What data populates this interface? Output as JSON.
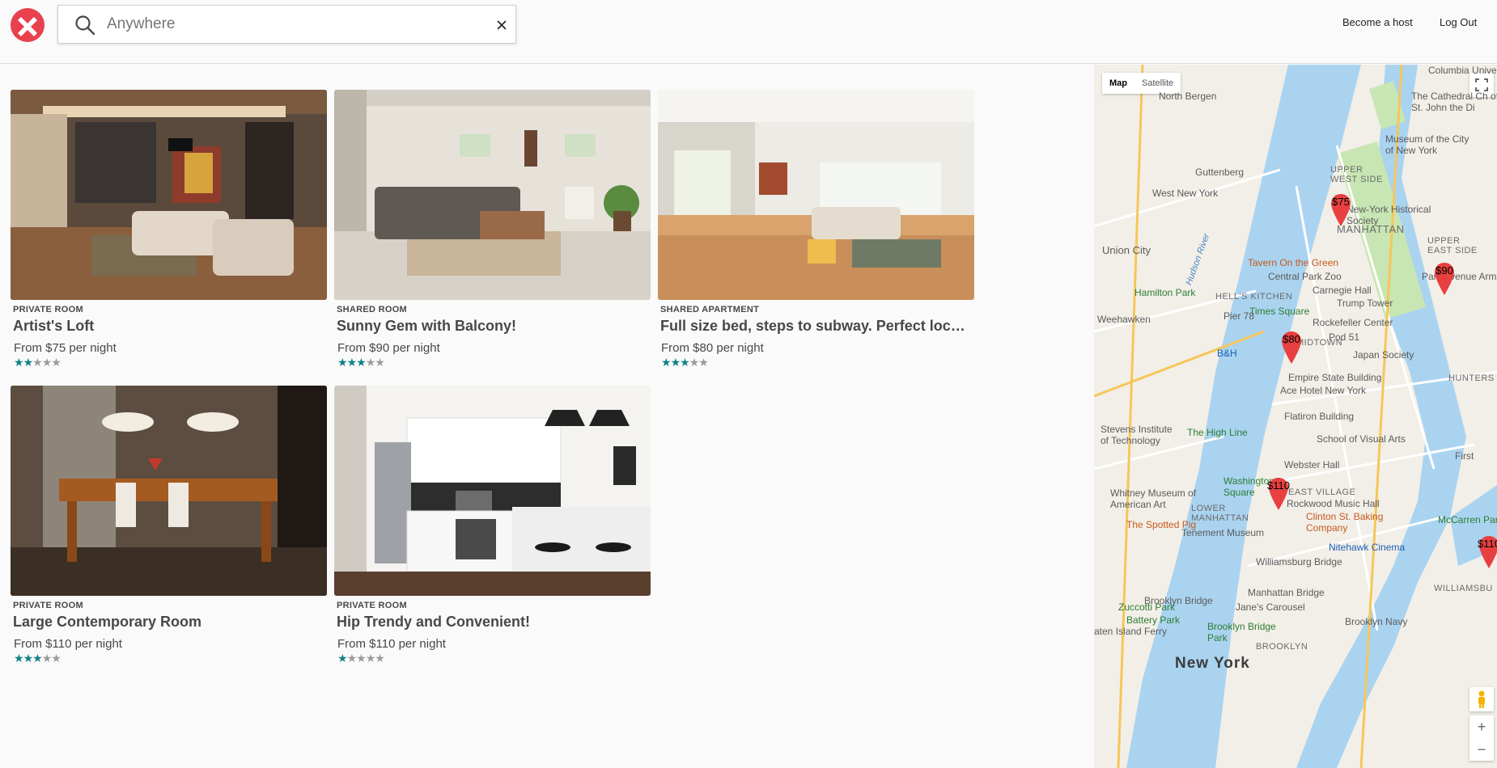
{
  "header": {
    "search": {
      "value": "",
      "placeholder": "Anywhere"
    },
    "nav": {
      "become_host": "Become a host",
      "logout": "Log Out"
    },
    "colors": {
      "brand": "#e8414d"
    }
  },
  "listings": [
    {
      "type": "PRIVATE ROOM",
      "title": "Artist's Loft",
      "price": "From $75 per night",
      "rating": 2,
      "max_rating": 5
    },
    {
      "type": "SHARED ROOM",
      "title": "Sunny Gem with Balcony!",
      "price": "From $90 per night",
      "rating": 3,
      "max_rating": 5
    },
    {
      "type": "SHARED APARTMENT",
      "title": "Full size bed, steps to subway. Perfect location!",
      "price": "From $80 per night",
      "rating": 3,
      "max_rating": 5
    },
    {
      "type": "PRIVATE ROOM",
      "title": "Large Contemporary Room",
      "price": "From $110 per night",
      "rating": 3,
      "max_rating": 5
    },
    {
      "type": "PRIVATE ROOM",
      "title": "Hip Trendy and Convenient!",
      "price": "From $110 per night",
      "rating": 1,
      "max_rating": 5
    }
  ],
  "map": {
    "type_controls": {
      "map": "Map",
      "satellite": "Satellite",
      "active": "Map"
    },
    "markers": [
      "$75",
      "$90",
      "$80",
      "$110",
      "$110"
    ],
    "labels": {
      "north_bergen": "North Bergen",
      "guttenberg": "Guttenberg",
      "west_new_york": "West New York",
      "union_city": "Union City",
      "hamilton_park": "Hamilton Park",
      "weehawken": "Weehawken",
      "stevens": "Stevens Institute of Technology",
      "high_line": "The High Line",
      "whitney": "Whitney Museum of American Art",
      "spotted_pig": "The Spotted Pig",
      "new_york": "New York",
      "manhattan": "MANHATTAN",
      "upper_west_side": "UPPER WEST SIDE",
      "upper_east_side": "UPPER EAST SIDE",
      "hells_kitchen": "HELL'S KITCHEN",
      "midtown": "MIDTOWN",
      "east_village": "EAST VILLAGE",
      "lower_manhattan": "LOWER MANHATTAN",
      "columbia": "Columbia Univers",
      "cathedral": "The Cathedral Ch of St. John the Di",
      "museum_cny": "Museum of the City of New York",
      "nyhs": "New-York Historical Society",
      "tavern": "Tavern On the Green",
      "central_park_zoo": "Central Park Zoo",
      "carnegie": "Carnegie Hall",
      "trump": "Trump Tower",
      "times_square": "Times Square",
      "rockefeller": "Rockefeller Center",
      "pier78": "Pier 78",
      "pod51": "Pod 51",
      "japan_society": "Japan Society",
      "bh": "B&H",
      "empire": "Empire State Building",
      "ace": "Ace Hotel New York",
      "flatiron": "Flatiron Building",
      "sva": "School of Visual Arts",
      "webster": "Webster Hall",
      "washington_sq": "Washington Square",
      "rockwood": "Rockwood Music Hall",
      "clinton": "Clinton St. Baking Company",
      "tenement": "Tenement Museum",
      "nitehawk": "Nitehawk Cinema",
      "williamsburg_bridge": "Williamsburg Bridge",
      "zuccotti": "Zuccotti Park",
      "manhattan_bridge": "Manhattan Bridge",
      "brooklyn_bridge": "Brooklyn Bridge",
      "janes": "Jane's Carousel",
      "battery": "Battery Park",
      "brooklyn_bridge_park": "Brooklyn Bridge Park",
      "staten": "aten Island Ferry",
      "brooklyn_navy": "Brooklyn Navy",
      "mccarren": "McCarren Par",
      "hudson_river": "Hudson River",
      "park_ave": "Park Avenue Arm",
      "hunters_point": "HUNTERS PO",
      "first": "First",
      "williamsburg": "WILLIAMSBU",
      "brooklyn": "BROOKLYN"
    }
  }
}
